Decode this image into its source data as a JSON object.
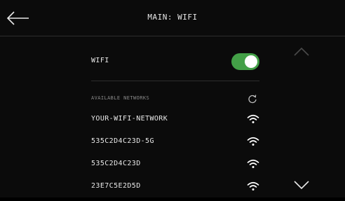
{
  "colors": {
    "accent": "#43a047",
    "background": "#0b0b0b",
    "text": "#e8e8e8",
    "muted": "#8a8a8a"
  },
  "header": {
    "title": "MAIN: WIFI",
    "back_icon": "arrow-left-icon"
  },
  "wifi": {
    "label": "WIFI",
    "enabled": true
  },
  "networks_section": {
    "label": "AVAILABLE NETWORKS",
    "refresh_icon": "refresh-icon"
  },
  "networks": [
    {
      "name": "YOUR-WIFI-NETWORK",
      "signal_icon": "wifi-signal-icon"
    },
    {
      "name": "535C2D4C23D-5G",
      "signal_icon": "wifi-signal-icon"
    },
    {
      "name": "535C2D4C23D",
      "signal_icon": "wifi-signal-icon"
    },
    {
      "name": "23E7C5E2D5D",
      "signal_icon": "wifi-signal-icon"
    }
  ],
  "scroll": {
    "up_icon": "chevron-up-icon",
    "down_icon": "chevron-down-icon"
  }
}
